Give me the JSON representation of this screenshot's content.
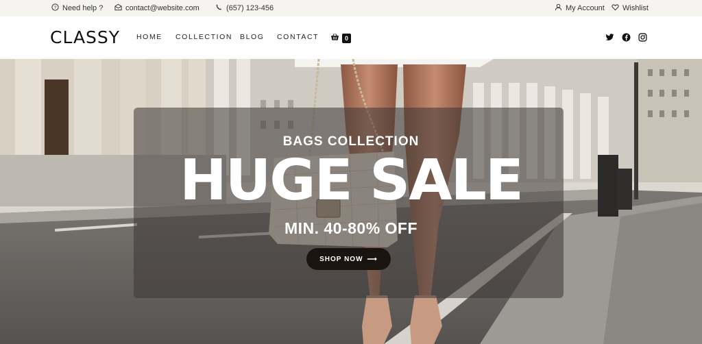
{
  "topbar": {
    "help_label": "Need help ?",
    "email": "contact@website.com",
    "phone": "(657) 123-456",
    "account_label": "My Account",
    "wishlist_label": "Wishlist"
  },
  "header": {
    "logo": "CLASSY",
    "nav": [
      "HOME",
      "COLLECTION",
      "BLOG",
      "CONTACT"
    ],
    "cart_count": "0",
    "social_icons": [
      "twitter-icon",
      "facebook-icon",
      "instagram-icon"
    ]
  },
  "hero": {
    "eyebrow": "BAGS COLLECTION",
    "headline": "HUGE SALE",
    "subline": "MIN. 40-80% OFF",
    "cta_label": "SHOP NOW",
    "cta_arrow": "⟶",
    "colors": {
      "overlay": "#3c3734",
      "cta_bg": "#1a1410",
      "text": "#ffffff"
    }
  }
}
